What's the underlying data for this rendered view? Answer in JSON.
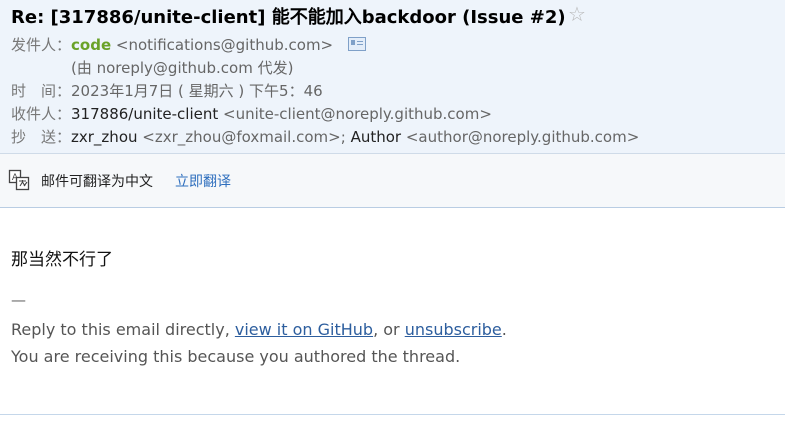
{
  "email": {
    "subject": "Re: [317886/unite-client] 能不能加入backdoor (Issue #2)",
    "star_icon": "star-icon",
    "from_label": "发件人：",
    "from_name": "code",
    "from_addr": "<notifications@github.com>",
    "via_text": "(由 noreply@github.com 代发)",
    "time_label": "时　间：",
    "time_value": "2023年1月7日 ( 星期六 ) 下午5：46",
    "to_label": "收件人：",
    "to_name": "317886/unite-client",
    "to_addr": "<unite-client@noreply.github.com>",
    "cc_label": "抄　送：",
    "cc_name1": "zxr_zhou",
    "cc_addr1": "<zxr_zhou@foxmail.com>;",
    "cc_name2": "Author",
    "cc_addr2": "<author@noreply.github.com>"
  },
  "translate": {
    "icon": "translate-icon",
    "text": "邮件可翻译为中文",
    "link": "立即翻译"
  },
  "content": {
    "body": "那当然不行了",
    "sig_dash": "—",
    "reply_prefix": "Reply to this email directly, ",
    "view_link": "view it on GitHub",
    "reply_mid": ", or ",
    "unsub_link": "unsubscribe",
    "reply_end": ".",
    "receiving": "You are receiving this because you authored the thread."
  }
}
